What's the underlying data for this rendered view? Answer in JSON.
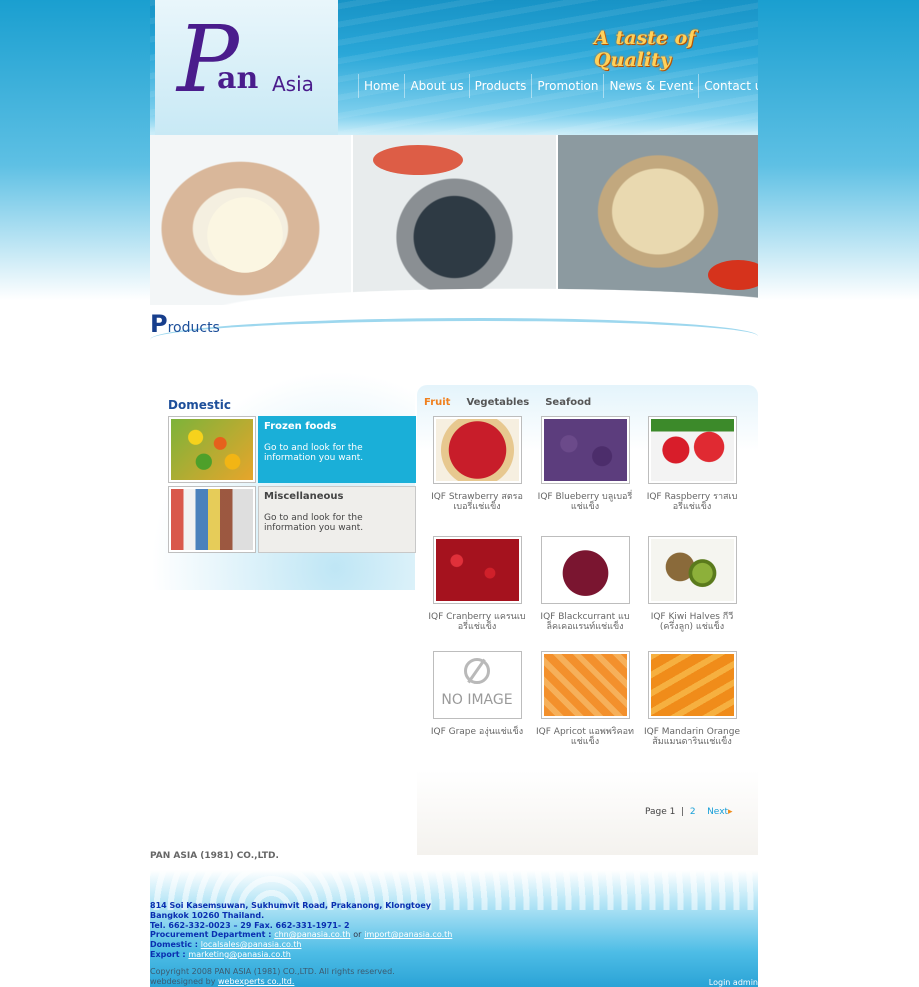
{
  "header": {
    "logo_p": "P",
    "logo_an": "an",
    "logo_asia": "Asia",
    "tagline": "A taste of Quality"
  },
  "nav": [
    "Home",
    "About us",
    "Products",
    "Promotion",
    "News & Event",
    "Contact us"
  ],
  "products_heading": {
    "first": "P",
    "rest": "roducts"
  },
  "domestic": {
    "title": "Domestic",
    "categories": [
      {
        "title": "Frozen foods",
        "desc": "Go to and look for the information you want."
      },
      {
        "title": "Miscellaneous",
        "desc": "Go to and look for the information you want."
      }
    ]
  },
  "tabs": [
    "Fruit",
    "Vegetables",
    "Seafood"
  ],
  "active_tab": "Fruit",
  "products": [
    {
      "name": "IQF Strawberry สตรอเบอรี่แช่แข็ง",
      "image": "strawberry"
    },
    {
      "name": "IQF Blueberry บลูเบอรี่แช่แข็ง",
      "image": "blueberry"
    },
    {
      "name": "IQF Raspberry ราสเบอรี่แช่แข็ง",
      "image": "raspberry"
    },
    {
      "name": "IQF Cranberry แครนเบอรี่แช่แข็ง",
      "image": "cranberry"
    },
    {
      "name": "IQF Blackcurrant แบล็คเคอแรนท์แช่แข็ง",
      "image": "blackcurrant"
    },
    {
      "name": "IQF Kiwi Halves กีวี (ครึ่งลูก) แช่แข็ง",
      "image": "kiwi"
    },
    {
      "name": "IQF Grape องุ่นแช่แข็ง",
      "image": "no-image",
      "placeholder": "NO IMAGE"
    },
    {
      "name": "IQF Apricot แอพพริคอทแช่แข็ง",
      "image": "apricot"
    },
    {
      "name": "IQF Mandarin Orange ส้มแมนดารินแช่แข็ง",
      "image": "mandarin"
    }
  ],
  "pager": {
    "label": "Page 1",
    "sep": "|",
    "page2": "2",
    "next": "Next"
  },
  "company": "PAN ASIA (1981) CO.,LTD.",
  "footer": {
    "address1": "814 Soi Kasemsuwan, Sukhumvit Road, Prakanong, Klongtoey",
    "address2": "Bangkok 10260 Thailand.",
    "tel": "Tel. 662-332-0023 – 29 Fax. 662-331-1971- 2",
    "procurement_label": "Procurement Department :",
    "procurement_email1": "chn@panasia.co.th",
    "or": "or",
    "procurement_email2": "import@panasia.co.th",
    "domestic_label": "Domestic :",
    "domestic_email": "localsales@panasia.co.th",
    "export_label": "Export :",
    "export_email": "marketing@panasia.co.th",
    "copyright": "Copyright 2008 PAN ASIA (1981) CO.,LTD. All rights reserved.",
    "webdesign_label": "webdesigned by",
    "webdesign_link": "webexperts co.,ltd.",
    "login": "Login admin"
  }
}
